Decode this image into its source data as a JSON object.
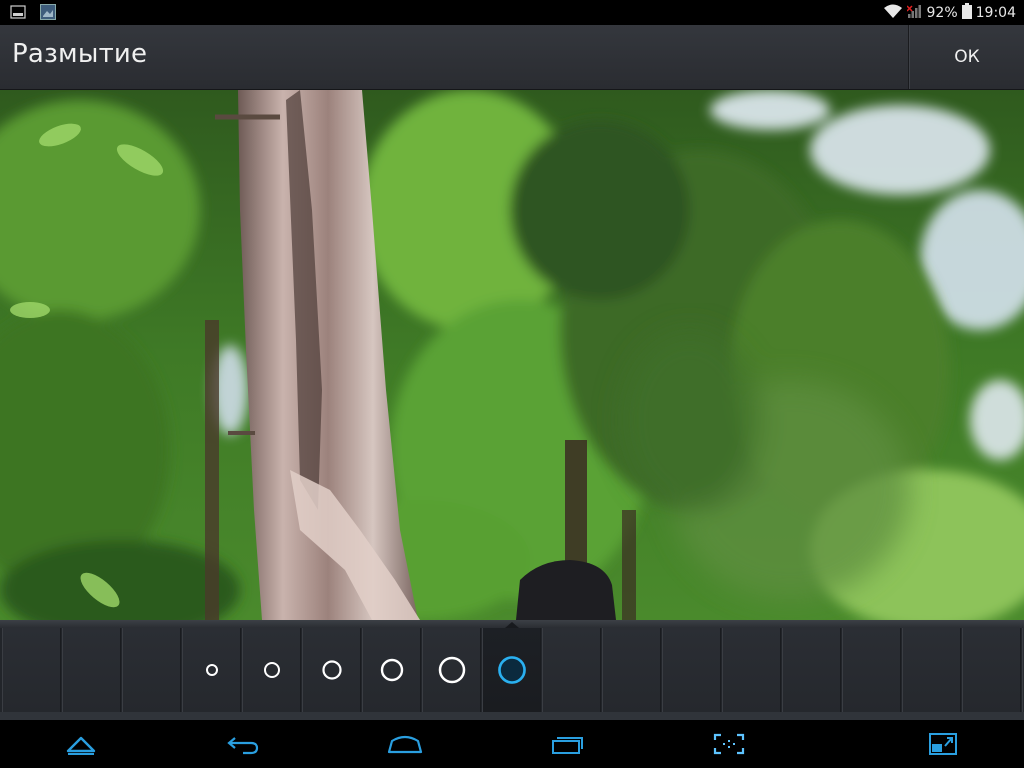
{
  "status_bar": {
    "battery_percent": "92%",
    "time": "19:04",
    "notifications": [
      "gallery-notification-icon",
      "photo-notification-icon"
    ],
    "icons": [
      "wifi-icon",
      "signal-icon",
      "battery-icon"
    ]
  },
  "action_bar": {
    "title": "Размытие",
    "ok_label": "ОК"
  },
  "brush_sizes": {
    "count_cells": 17,
    "sizes": [
      {
        "index": 3,
        "level": 1
      },
      {
        "index": 4,
        "level": 2
      },
      {
        "index": 5,
        "level": 3
      },
      {
        "index": 6,
        "level": 4
      },
      {
        "index": 7,
        "level": 5
      },
      {
        "index": 8,
        "level": 6,
        "selected": true
      }
    ]
  },
  "nav_bar": {
    "buttons": [
      "hide-bar-icon",
      "back-icon",
      "home-icon",
      "recent-apps-icon",
      "screenshot-icon",
      "multiwindow-icon"
    ]
  },
  "colors": {
    "accent": "#2a9fe0",
    "bar_bg": "#2e3136",
    "status_bg": "#000000",
    "text": "#f0f0f0"
  }
}
